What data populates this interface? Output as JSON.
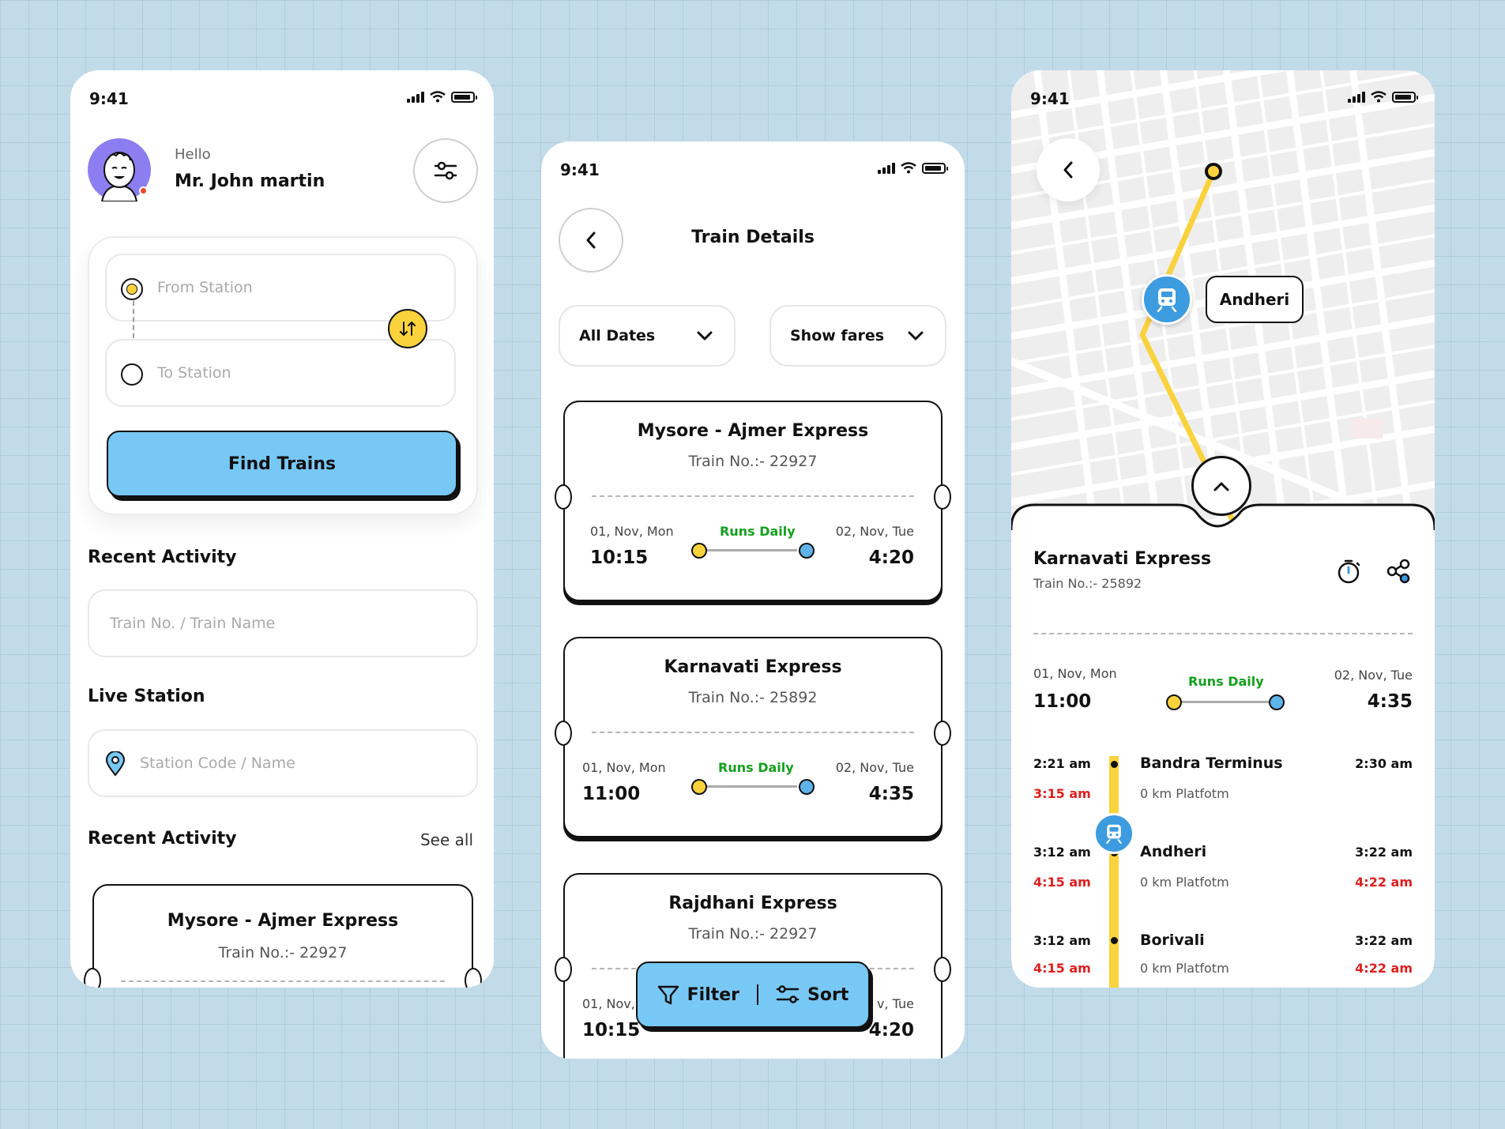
{
  "status": {
    "time": "9:41"
  },
  "home": {
    "greeting": "Hello",
    "user_name": "Mr. John martin",
    "from_placeholder": "From Station",
    "to_placeholder": "To Station",
    "find_button": "Find Trains",
    "recent_activity_title": "Recent Activity",
    "train_search_placeholder": "Train No. / Train Name",
    "live_station_title": "Live Station",
    "station_search_placeholder": "Station Code / Name",
    "recent_activity_title_2": "Recent Activity",
    "see_all": "See all",
    "recent_ticket": {
      "name": "Mysore - Ajmer Express",
      "number": "Train No.:- 22927"
    }
  },
  "details": {
    "title": "Train Details",
    "dropdown_dates": "All Dates",
    "dropdown_fares": "Show fares",
    "tickets": [
      {
        "name": "Mysore - Ajmer Express",
        "number": "Train No.:- 22927",
        "from_date": "01, Nov, Mon",
        "from_time": "10:15",
        "runs": "Runs Daily",
        "to_date": "02, Nov, Tue",
        "to_time": "4:20"
      },
      {
        "name": "Karnavati Express",
        "number": "Train No.:- 25892",
        "from_date": "01, Nov, Mon",
        "from_time": "11:00",
        "runs": "Runs Daily",
        "to_date": "02, Nov, Tue",
        "to_time": "4:35"
      },
      {
        "name": "Rajdhani Express",
        "number": "Train No.:- 22927",
        "from_date": "01, Nov,",
        "from_time": "10:15",
        "runs": "",
        "to_date": "v, Tue",
        "to_time": "4:20"
      }
    ],
    "filter_label": "Filter",
    "sort_label": "Sort"
  },
  "live": {
    "map_station_label": "Andheri",
    "train_name": "Karnavati Express",
    "train_number": "Train No.:- 25892",
    "from_date": "01, Nov, Mon",
    "from_time": "11:00",
    "runs": "Runs Daily",
    "to_date": "02, Nov, Tue",
    "to_time": "4:35",
    "stops": [
      {
        "arr": "2:21 am",
        "arr_delay": "3:15 am",
        "name": "Bandra Terminus",
        "platform": "0 km Platfotm",
        "dep": "2:30 am",
        "dep_delay": ""
      },
      {
        "arr": "3:12 am",
        "arr_delay": "4:15 am",
        "name": "Andheri",
        "platform": "0 km Platfotm",
        "dep": "3:22 am",
        "dep_delay": "4:22 am"
      },
      {
        "arr": "3:12 am",
        "arr_delay": "4:15 am",
        "name": "Borivali",
        "platform": "0 km Platfotm",
        "dep": "3:22 am",
        "dep_delay": "4:22 am"
      }
    ]
  },
  "colors": {
    "accent_blue": "#78c8f5",
    "accent_yellow": "#f9d23c",
    "runs_green": "#14a01e",
    "delay_red": "#e11d1d",
    "bg": "#c2dbe9"
  }
}
